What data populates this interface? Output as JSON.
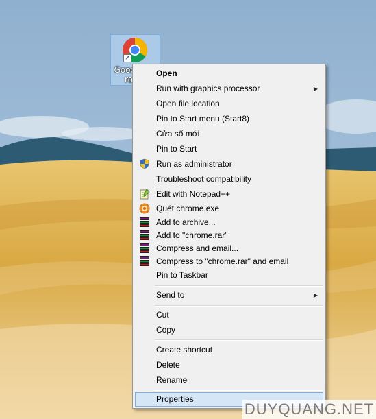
{
  "desktop": {
    "shortcut": {
      "label": "Google Chrome",
      "icon": "chrome-icon",
      "overlay_icon": "shortcut-arrow-icon"
    }
  },
  "context_menu": {
    "items": [
      {
        "label": "Open",
        "bold": true
      },
      {
        "label": "Run with graphics processor",
        "submenu": true
      },
      {
        "label": "Open file location"
      },
      {
        "label": "Pin to Start menu (Start8)"
      },
      {
        "label": "Cửa sổ mới"
      },
      {
        "label": "Pin to Start"
      },
      {
        "label": "Run as administrator",
        "icon": "uac-shield-icon"
      },
      {
        "label": "Troubleshoot compatibility"
      },
      {
        "label": "Edit with Notepad++",
        "icon": "notepad-plus-plus-icon"
      },
      {
        "label": "Quét chrome.exe",
        "icon": "antivirus-scan-icon"
      },
      {
        "label": "Add to archive...",
        "icon": "winrar-icon"
      },
      {
        "label": "Add to \"chrome.rar\"",
        "icon": "winrar-icon"
      },
      {
        "label": "Compress and email...",
        "icon": "winrar-icon"
      },
      {
        "label": "Compress to \"chrome.rar\" and email",
        "icon": "winrar-icon"
      },
      {
        "label": "Pin to Taskbar"
      },
      {
        "label": "Send to",
        "submenu": true
      },
      {
        "label": "Cut"
      },
      {
        "label": "Copy"
      },
      {
        "label": "Create shortcut"
      },
      {
        "label": "Delete"
      },
      {
        "label": "Rename"
      },
      {
        "label": "Properties",
        "highlighted": true
      }
    ],
    "submenu_arrow": "▶"
  },
  "watermark": "DUYQUANG.NET",
  "colors": {
    "menu_background": "#f0f0f0",
    "menu_border": "#979797",
    "highlight_background": "#d5e6f7",
    "highlight_border": "#7ab0e6"
  }
}
